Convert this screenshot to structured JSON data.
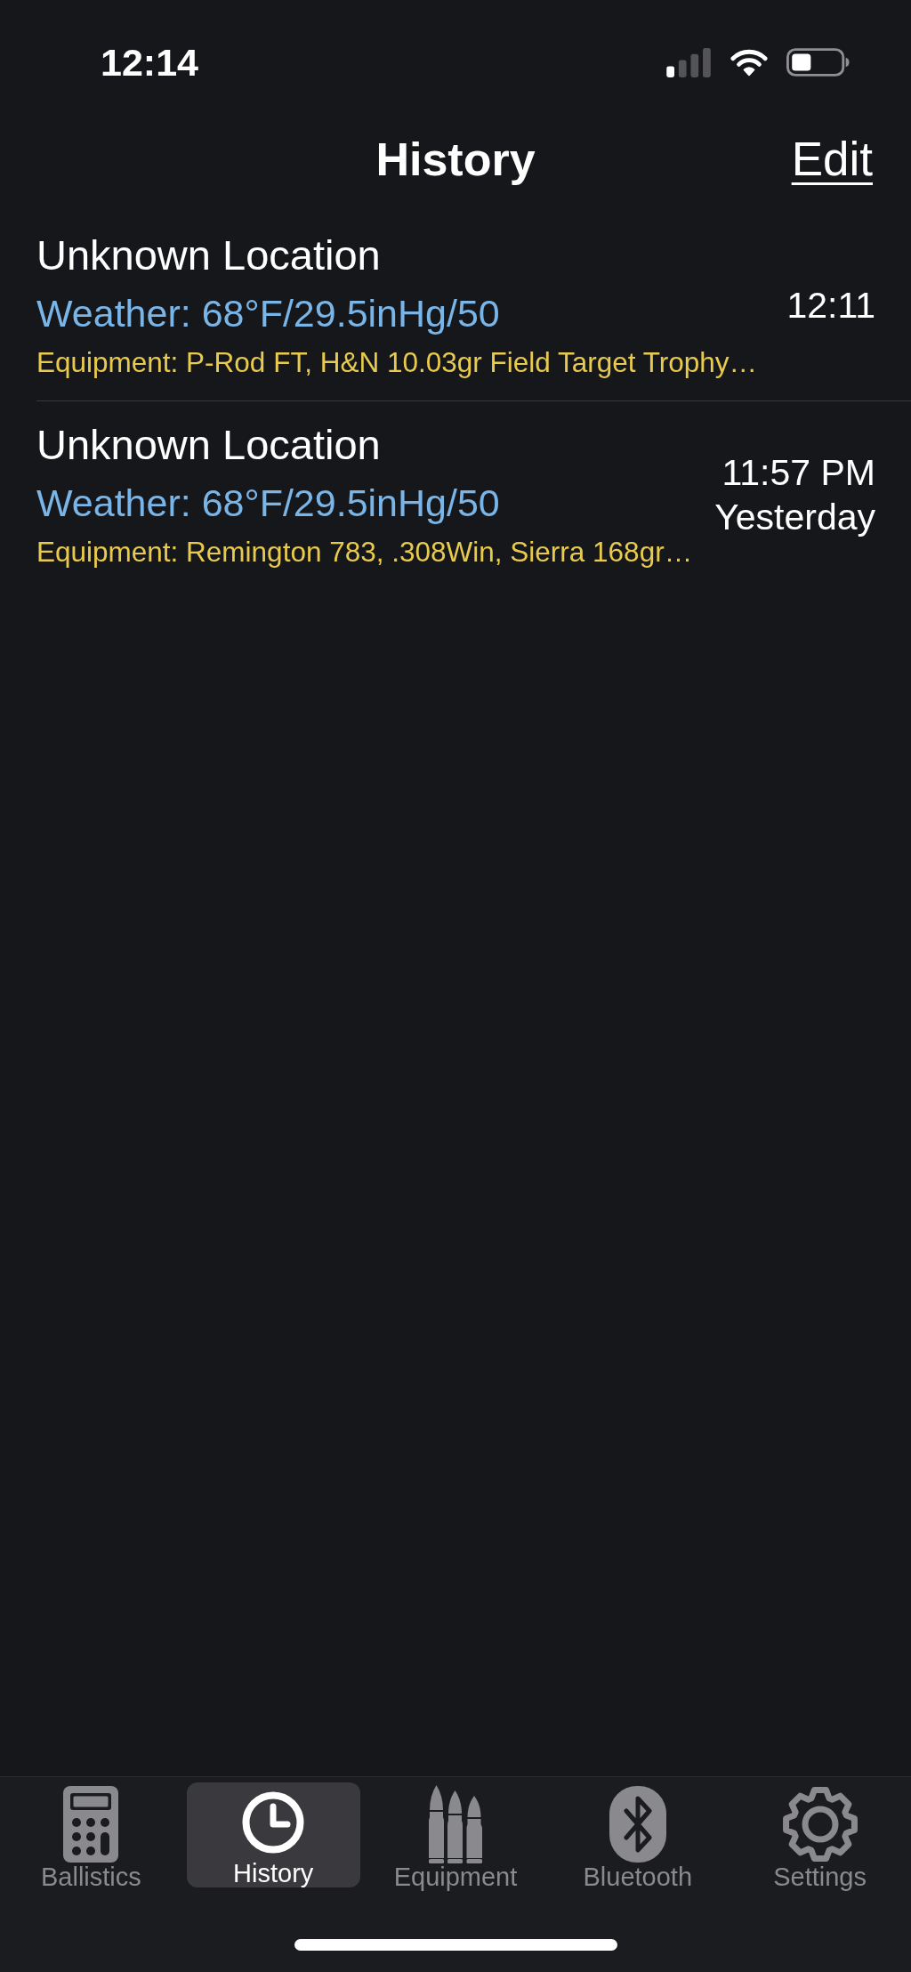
{
  "status_bar": {
    "time": "12:14"
  },
  "header": {
    "title": "History",
    "action": "Edit"
  },
  "history": [
    {
      "location": "Unknown Location",
      "weather": "Weather: 68°F/29.5inHg/50",
      "equipment": "Equipment: P-Rod FT, H&N 10.03gr Field Target Trophy…",
      "time": "12:11"
    },
    {
      "location": "Unknown Location",
      "weather": "Weather: 68°F/29.5inHg/50",
      "equipment": "Equipment: Remington 783, .308Win, Sierra 168gr…",
      "time": "11:57 PM",
      "day": "Yesterday"
    }
  ],
  "tab_bar": [
    {
      "label": "Ballistics",
      "kind": "ballistics",
      "selected": false
    },
    {
      "label": "History",
      "kind": "history",
      "selected": true
    },
    {
      "label": "Equipment",
      "kind": "equipment",
      "selected": false
    },
    {
      "label": "Bluetooth",
      "kind": "bluetooth",
      "selected": false
    },
    {
      "label": "Settings",
      "kind": "settings",
      "selected": false
    }
  ]
}
